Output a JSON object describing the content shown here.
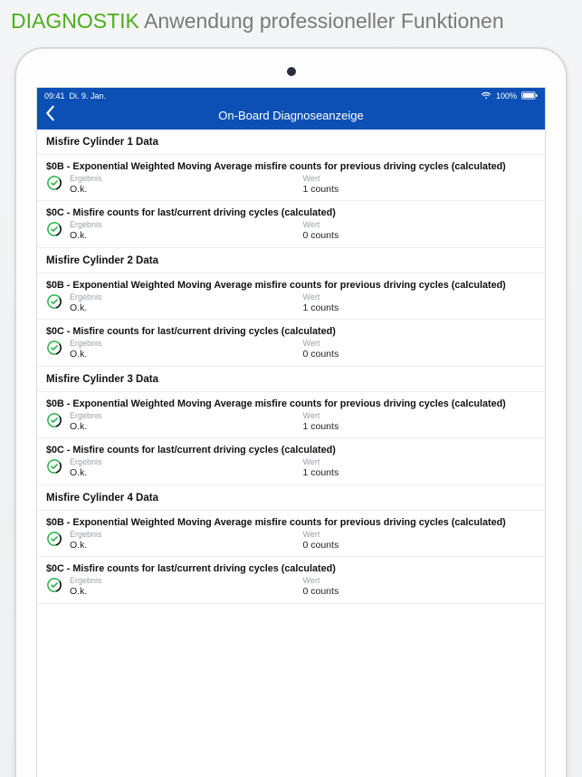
{
  "promo": {
    "green": "DIAGNOSTIK",
    "rest": "Anwendung professioneller Funktionen"
  },
  "status": {
    "time": "09:41",
    "date": "Di. 9. Jan.",
    "battery": "100%"
  },
  "nav": {
    "title": "On-Board Diagnoseanzeige"
  },
  "labels": {
    "result": "Ergebnis",
    "value": "Wert",
    "ok": "O.k."
  },
  "sections": [
    {
      "header": "Misfire Cylinder 1 Data",
      "items": [
        {
          "title": "$0B - Exponential Weighted Moving Average misfire counts for previous driving cycles (calculated)",
          "result": "O.k.",
          "value": "1 counts"
        },
        {
          "title": "$0C - Misfire counts for last/current driving cycles (calculated)",
          "result": "O.k.",
          "value": "0 counts"
        }
      ]
    },
    {
      "header": "Misfire Cylinder 2 Data",
      "items": [
        {
          "title": "$0B - Exponential Weighted Moving Average misfire counts for previous driving cycles (calculated)",
          "result": "O.k.",
          "value": "1 counts"
        },
        {
          "title": "$0C - Misfire counts for last/current driving cycles (calculated)",
          "result": "O.k.",
          "value": "0 counts"
        }
      ]
    },
    {
      "header": "Misfire Cylinder 3 Data",
      "items": [
        {
          "title": "$0B - Exponential Weighted Moving Average misfire counts for previous driving cycles (calculated)",
          "result": "O.k.",
          "value": "1 counts"
        },
        {
          "title": "$0C - Misfire counts for last/current driving cycles (calculated)",
          "result": "O.k.",
          "value": "1 counts"
        }
      ]
    },
    {
      "header": "Misfire Cylinder 4 Data",
      "items": [
        {
          "title": "$0B - Exponential Weighted Moving Average misfire counts for previous driving cycles (calculated)",
          "result": "O.k.",
          "value": "0 counts"
        },
        {
          "title": "$0C - Misfire counts for last/current driving cycles (calculated)",
          "result": "O.k.",
          "value": "0 counts"
        }
      ]
    }
  ]
}
